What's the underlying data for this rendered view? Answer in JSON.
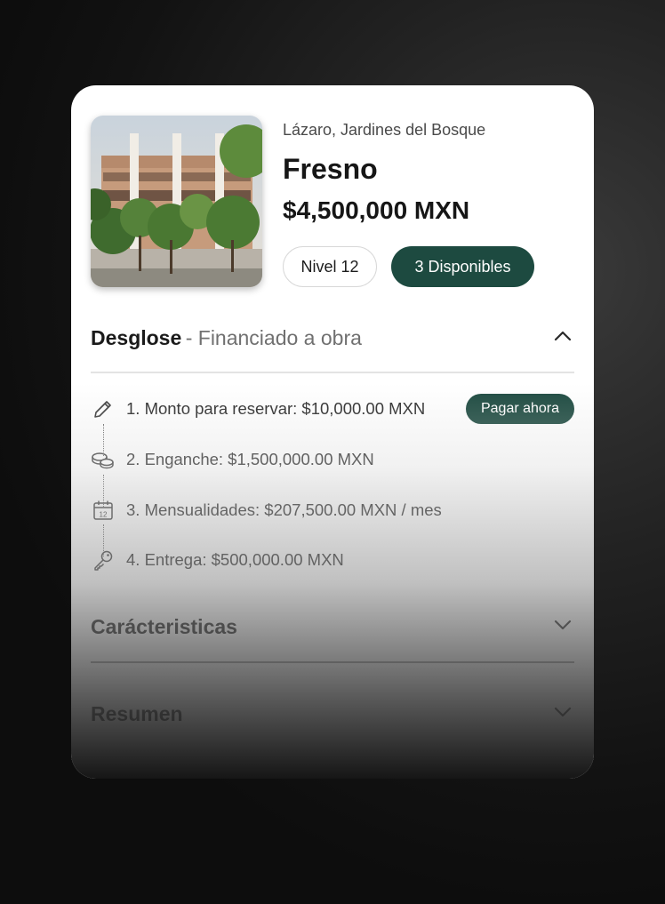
{
  "property": {
    "location": "Lázaro, Jardines del Bosque",
    "name": "Fresno",
    "price": "$4,500,000 MXN",
    "level_badge": "Nivel 12",
    "availability_badge": "3 Disponibles"
  },
  "breakdown": {
    "title": "Desglose",
    "subtitle": "- Financiado a obra",
    "steps": [
      {
        "label": "1. Monto para reservar: $10,000.00 MXN",
        "icon": "pencil-icon"
      },
      {
        "label": "2. Enganche: $1,500,000.00 MXN",
        "icon": "coins-icon"
      },
      {
        "label": "3. Mensualidades: $207,500.00 MXN / mes",
        "icon": "calendar-icon"
      },
      {
        "label": "4. Entrega: $500,000.00 MXN",
        "icon": "key-icon"
      }
    ],
    "pay_button": "Pagar ahora",
    "calendar_day": "12"
  },
  "sections": {
    "features": "Carácteristicas",
    "summary": "Resumen"
  },
  "colors": {
    "accent": "#1d4a40",
    "card": "#ffffff",
    "background": "#121212"
  }
}
